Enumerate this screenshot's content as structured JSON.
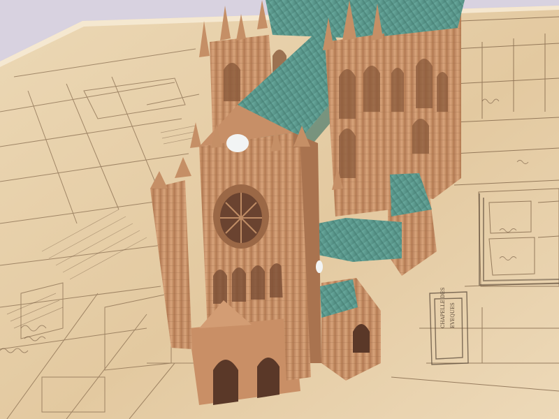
{
  "scene": {
    "plan_labels": [
      {
        "text": "CHAPELLE DES",
        "lines": 2
      },
      {
        "text": "EVEQUES"
      }
    ],
    "colors": {
      "background": "#d8d2e0",
      "paper": "#e8d2ad",
      "paper_light": "#f0dfc0",
      "ink": "#7a5e42",
      "stone": "#c9946b",
      "stone_dark": "#a8754f",
      "stone_shadow": "#8e5f3f",
      "roof": "#5f9f93",
      "roof_dark": "#467f75",
      "window": "#f2f4f4"
    }
  }
}
